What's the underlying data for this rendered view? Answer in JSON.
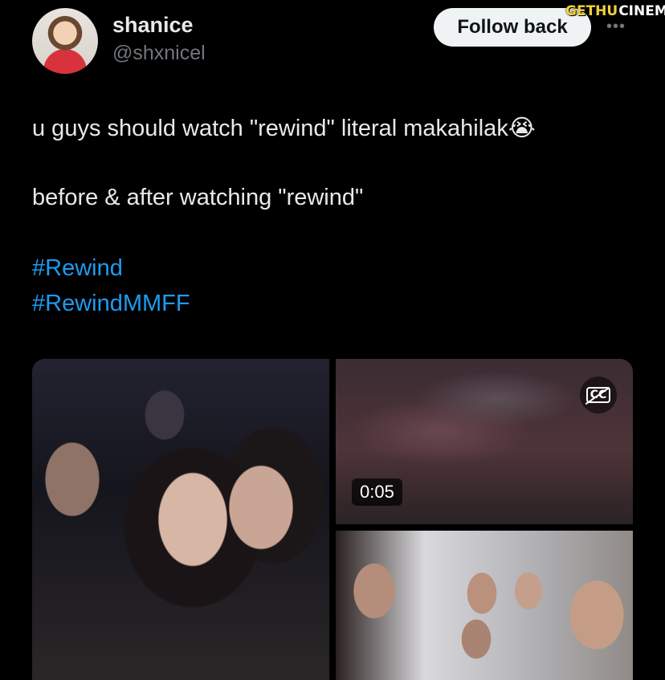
{
  "user": {
    "name": "shanice",
    "handle": "@shxnicel"
  },
  "actions": {
    "follow_label": "Follow back",
    "more_icon": "•••"
  },
  "watermark": {
    "part1": "GETHU",
    "part2": "CINEMA"
  },
  "tweet": {
    "line1": "u guys should watch \"rewind\" literal makahilak",
    "line1_emoji": "😭",
    "line2": "before & after watching \"rewind\"",
    "hashtags": [
      "#Rewind",
      "#RewindMMFF"
    ]
  },
  "media": {
    "video_duration": "0:05",
    "captions_icon": "cc-off-icon",
    "captions_label": "CC"
  },
  "colors": {
    "background": "#000000",
    "text": "#e7e9ea",
    "secondary_text": "#71767b",
    "link": "#1d9bf0",
    "button_bg": "#eff3f4"
  }
}
